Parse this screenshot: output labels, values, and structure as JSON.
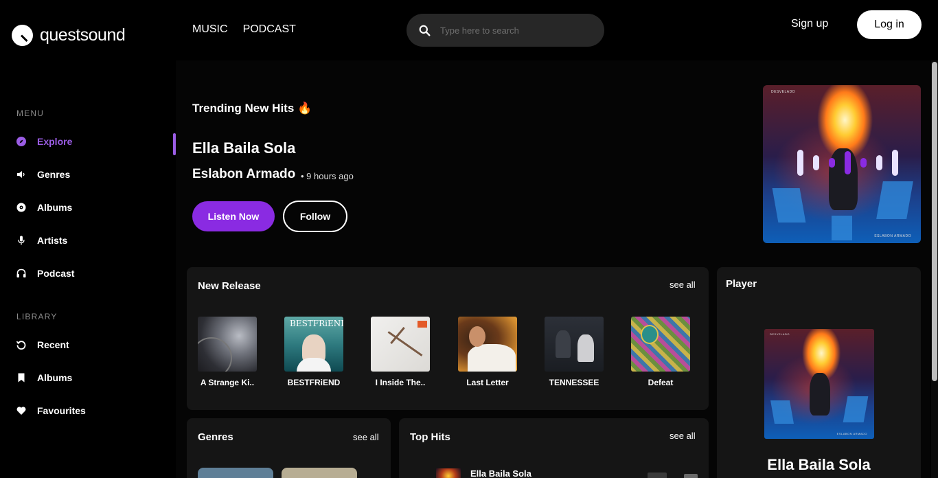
{
  "brand": {
    "name": "questsound"
  },
  "topnav": {
    "music": "MUSIC",
    "podcast": "PODCAST"
  },
  "search": {
    "placeholder": "Type here to search",
    "value": ""
  },
  "auth": {
    "signup": "Sign up",
    "login": "Log in"
  },
  "sidebar": {
    "menu_label": "MENU",
    "menu": [
      {
        "label": "Explore",
        "icon": "compass-icon",
        "active": true
      },
      {
        "label": "Genres",
        "icon": "speaker-icon"
      },
      {
        "label": "Albums",
        "icon": "disc-icon"
      },
      {
        "label": "Artists",
        "icon": "microphone-icon"
      },
      {
        "label": "Podcast",
        "icon": "headphones-icon"
      }
    ],
    "library_label": "LIBRARY",
    "library": [
      {
        "label": "Recent",
        "icon": "history-icon"
      },
      {
        "label": "Albums",
        "icon": "bookmark-icon"
      },
      {
        "label": "Favourites",
        "icon": "heart-icon"
      }
    ]
  },
  "hero": {
    "tag": "Trending New Hits 🔥",
    "title": "Ella Baila Sola",
    "artist": "Eslabon Armado",
    "time": "• 9 hours ago",
    "listen_button": "Listen Now",
    "follow_button": "Follow",
    "cover_top_text": "DESVELADO",
    "cover_bottom_text": "ESLABON ARMADO"
  },
  "new_release": {
    "title": "New Release",
    "see_all": "see all",
    "items": [
      {
        "label": "A Strange Ki..",
        "art": "gray-abstract"
      },
      {
        "label": "BESTFRiEND",
        "art": "teal-portrait",
        "art_text": "BESTFRiEND"
      },
      {
        "label": "I Inside The..",
        "art": "white-branch"
      },
      {
        "label": "Last Letter",
        "art": "warm-portrait"
      },
      {
        "label": "TENNESSEE",
        "art": "dark-duo"
      },
      {
        "label": "Defeat",
        "art": "pattern-collage"
      }
    ]
  },
  "player": {
    "title": "Player",
    "track_title": "Ella Baila Sola",
    "cover_top_text": "DESVELADO",
    "cover_bottom_text": "ESLABON ARMADO"
  },
  "genres": {
    "title": "Genres",
    "see_all": "see all"
  },
  "top_hits": {
    "title": "Top Hits",
    "see_all": "see all",
    "first_track": "Ella Baila Sola"
  },
  "colors": {
    "accent": "#8a2be2",
    "card": "#151515",
    "background": "#000000"
  }
}
